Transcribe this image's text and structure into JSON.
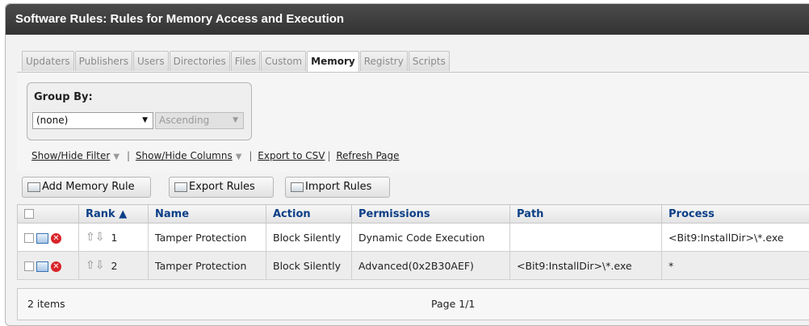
{
  "window": {
    "title": "Software Rules: Rules for Memory Access and Execution"
  },
  "tabs": [
    "Updaters",
    "Publishers",
    "Users",
    "Directories",
    "Files",
    "Custom",
    "Memory",
    "Registry",
    "Scripts"
  ],
  "active_tab": "Memory",
  "group_by": {
    "label": "Group By:",
    "value": "(none)",
    "order": "Ascending"
  },
  "links": {
    "filter": "Show/Hide Filter",
    "columns": "Show/Hide Columns",
    "export_csv": "Export to CSV",
    "refresh": "Refresh Page"
  },
  "toolbar": {
    "add": "Add Memory Rule",
    "export": "Export Rules",
    "import": "Import Rules"
  },
  "columns": [
    "Rank ▲",
    "Name",
    "Action",
    "Permissions",
    "Path",
    "Process"
  ],
  "rows": [
    {
      "rank": "1",
      "name": "Tamper Protection",
      "action": "Block Silently",
      "permissions": "Dynamic Code Execution",
      "path": "",
      "process": "<Bit9:InstallDir>\\*.exe"
    },
    {
      "rank": "2",
      "name": "Tamper Protection",
      "action": "Block Silently",
      "permissions": "Advanced(0x2B30AEF)",
      "path": "<Bit9:InstallDir>\\*.exe",
      "process": "*"
    }
  ],
  "footer": {
    "count": "2 items",
    "page": "Page 1/1"
  },
  "icons": {
    "edit": "edit-icon",
    "delete": "delete-icon",
    "up": "arrow-up-icon",
    "down": "arrow-down-icon",
    "dropdown": "chevron-down-icon"
  },
  "colors": {
    "titlebar": "#3c3c3c",
    "header_text": "#0c3f86",
    "delete_icon": "#d8242a"
  }
}
